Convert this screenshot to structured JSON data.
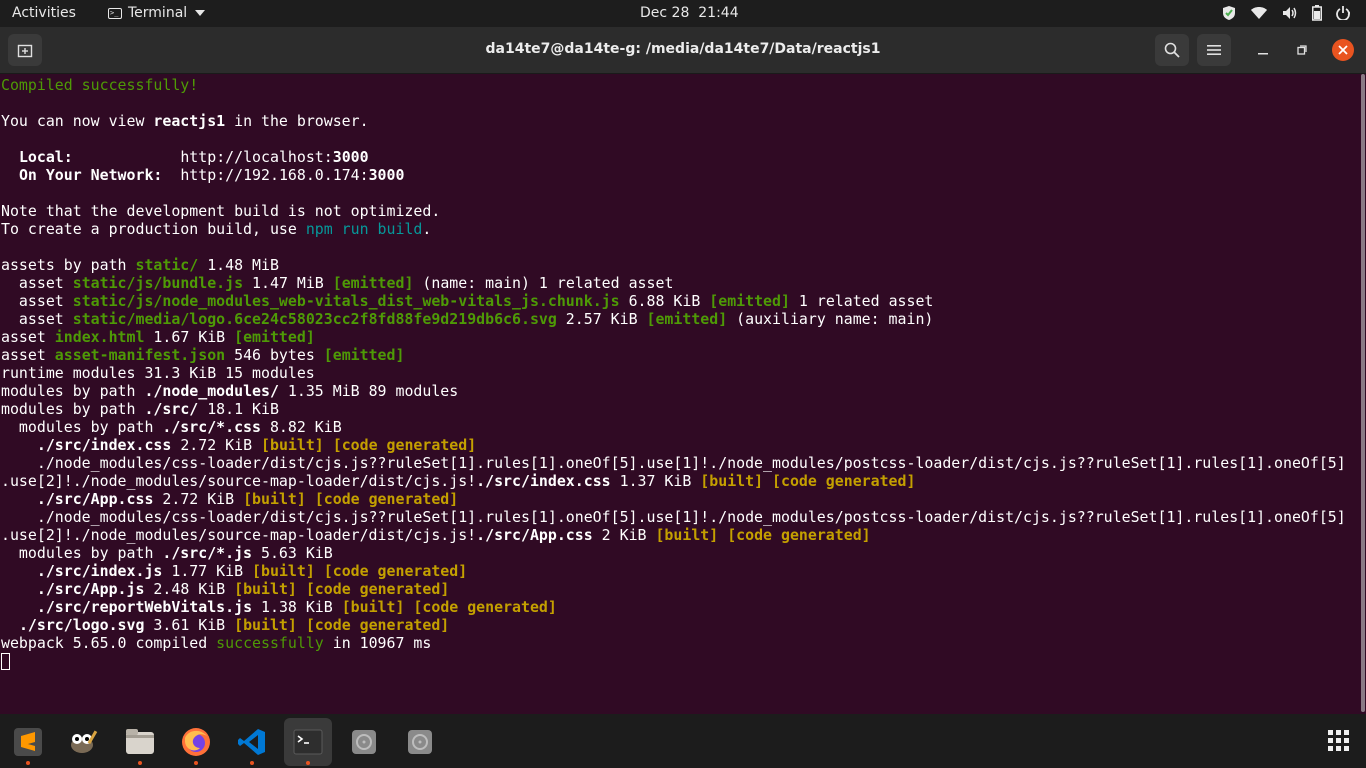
{
  "topbar": {
    "activities": "Activities",
    "app_name": "Terminal",
    "datetime": "Dec 28  21:44",
    "tray_icons": [
      "shield-icon",
      "wifi-icon",
      "volume-icon",
      "battery-icon",
      "power-icon"
    ]
  },
  "window": {
    "title": "da14te7@da14te-g: /media/da14te7/Data/reactjs1"
  },
  "colors": {
    "terminal_bg": "#300a24",
    "green": "#4e9a06",
    "yellow": "#c4a000",
    "cyan": "#06989a",
    "accent": "#e95420"
  },
  "terminal": {
    "compiled": "Compiled successfully!",
    "view_pre": "You can now view ",
    "view_app": "reactjs1",
    "view_post": " in the browser.",
    "local_label": "Local:",
    "local_url": "http://localhost:",
    "local_port": "3000",
    "network_label": "On Your Network:",
    "network_url": "http://192.168.0.174:",
    "network_port": "3000",
    "note_line": "Note that the development build is not optimized.",
    "create_pre": "To create a production build, use ",
    "create_cmd": "npm run build",
    "create_post": ".",
    "assets_pre": "assets by path ",
    "assets_path": "static/",
    "assets_size": " 1.48 MiB",
    "a1_pre": "  asset ",
    "a1_file": "static/js/bundle.js",
    "a1_size": " 1.47 MiB ",
    "a1_tag": "[emitted]",
    "a1_post": " (name: main) 1 related asset",
    "a2_pre": "  asset ",
    "a2_file": "static/js/node_modules_web-vitals_dist_web-vitals_js.chunk.js",
    "a2_size": " 6.88 KiB ",
    "a2_tag": "[emitted]",
    "a2_post": " 1 related asset",
    "a3_pre": "  asset ",
    "a3_file": "static/media/logo.6ce24c58023cc2f8fd88fe9d219db6c6.svg",
    "a3_size": " 2.57 KiB ",
    "a3_tag": "[emitted]",
    "a3_post": " (auxiliary name: main)",
    "a4_pre": "asset ",
    "a4_file": "index.html",
    "a4_size": " 1.67 KiB ",
    "a4_tag": "[emitted]",
    "a5_pre": "asset ",
    "a5_file": "asset-manifest.json",
    "a5_size": " 546 bytes ",
    "a5_tag": "[emitted]",
    "runtime_line": "runtime modules 31.3 KiB 15 modules",
    "m1_pre": "modules by path ",
    "m1_path": "./node_modules/",
    "m1_post": " 1.35 MiB 89 modules",
    "m2_pre": "modules by path ",
    "m2_path": "./src/",
    "m2_post": " 18.1 KiB",
    "m3_pre": "  modules by path ",
    "m3_path": "./src/*.css",
    "m3_post": " 8.82 KiB",
    "f1_pre": "    ",
    "f1_file": "./src/index.css",
    "f1_size": " 2.72 KiB ",
    "f1_tag": "[built] [code generated]",
    "long1a": "    ./node_modules/css-loader/dist/cjs.js??ruleSet[1].rules[1].oneOf[5].use[1]!./node_modules/postcss-loader/dist/cjs.js??ruleSet[1].rules[1].oneOf[5]",
    "long1b_pre": ".use[2]!./node_modules/source-map-loader/dist/cjs.js!",
    "long1b_file": "./src/index.css",
    "long1b_size": " 1.37 KiB ",
    "long1b_tag": "[built] [code generated]",
    "f2_pre": "    ",
    "f2_file": "./src/App.css",
    "f2_size": " 2.72 KiB ",
    "f2_tag": "[built] [code generated]",
    "long2a": "    ./node_modules/css-loader/dist/cjs.js??ruleSet[1].rules[1].oneOf[5].use[1]!./node_modules/postcss-loader/dist/cjs.js??ruleSet[1].rules[1].oneOf[5]",
    "long2b_pre": ".use[2]!./node_modules/source-map-loader/dist/cjs.js!",
    "long2b_file": "./src/App.css",
    "long2b_size": " 2 KiB ",
    "long2b_tag": "[built] [code generated]",
    "m4_pre": "  modules by path ",
    "m4_path": "./src/*.js",
    "m4_post": " 5.63 KiB",
    "j1_pre": "    ",
    "j1_file": "./src/index.js",
    "j1_size": " 1.77 KiB ",
    "j1_tag": "[built] [code generated]",
    "j2_pre": "    ",
    "j2_file": "./src/App.js",
    "j2_size": " 2.48 KiB ",
    "j2_tag": "[built] [code generated]",
    "j3_pre": "    ",
    "j3_file": "./src/reportWebVitals.js",
    "j3_size": " 1.38 KiB ",
    "j3_tag": "[built] [code generated]",
    "j4_pre": "  ",
    "j4_file": "./src/logo.svg",
    "j4_size": " 3.61 KiB ",
    "j4_tag": "[built] [code generated]",
    "wp_pre": "webpack 5.65.0 compiled ",
    "wp_status": "successfully",
    "wp_post": " in 10967 ms"
  },
  "dock": {
    "items": [
      {
        "name": "sublime-text-icon",
        "running": true
      },
      {
        "name": "gimp-icon",
        "running": false
      },
      {
        "name": "files-icon",
        "running": true
      },
      {
        "name": "firefox-icon",
        "running": true
      },
      {
        "name": "vscode-icon",
        "running": true
      },
      {
        "name": "terminal-icon",
        "running": true
      },
      {
        "name": "disk-icon",
        "running": false
      },
      {
        "name": "disk-icon",
        "running": false
      }
    ],
    "apps_grid": "show-applications-icon"
  }
}
